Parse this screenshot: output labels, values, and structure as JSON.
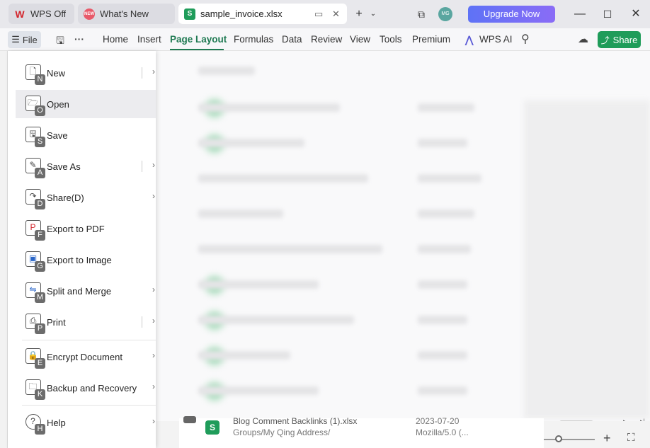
{
  "tabs": [
    {
      "label": "WPS Off",
      "icon": "wps-logo-icon"
    },
    {
      "label": "What's New",
      "icon": "new-badge-icon"
    },
    {
      "label": "sample_invoice.xlsx",
      "icon": "spreadsheet-icon"
    }
  ],
  "titlebar": {
    "avatar_text": "MG",
    "upgrade_label": "Upgrade Now"
  },
  "menubar": {
    "file_label": "File",
    "items": [
      "Home",
      "Insert",
      "Page Layout",
      "Formulas",
      "Data",
      "Review",
      "View",
      "Tools",
      "Premium"
    ],
    "active_item": "Page Layout",
    "wps_ai_label": "WPS AI",
    "share_label": "Share"
  },
  "file_menu": {
    "items": [
      {
        "label": "New",
        "key": "N",
        "submenu": true,
        "icon": "new-document-icon"
      },
      {
        "label": "Open",
        "key": "O",
        "submenu": false,
        "icon": "open-folder-icon"
      },
      {
        "label": "Save",
        "key": "S",
        "submenu": false,
        "icon": "save-icon"
      },
      {
        "label": "Save As",
        "key": "A",
        "submenu": true,
        "icon": "save-as-icon"
      },
      {
        "label": "Share(D)",
        "key": "D",
        "submenu": true,
        "icon": "share-icon"
      },
      {
        "label": "Export to PDF",
        "key": "F",
        "submenu": false,
        "icon": "pdf-icon"
      },
      {
        "label": "Export to Image",
        "key": "G",
        "submenu": false,
        "icon": "image-icon"
      },
      {
        "label": "Split and Merge",
        "key": "M",
        "submenu": true,
        "icon": "split-merge-icon"
      },
      {
        "label": "Print",
        "key": "P",
        "submenu": true,
        "icon": "print-icon"
      },
      {
        "label": "Encrypt Document",
        "key": "E",
        "submenu": true,
        "icon": "encrypt-icon"
      },
      {
        "label": "Backup and Recovery",
        "key": "K",
        "submenu": true,
        "icon": "backup-icon"
      },
      {
        "label": "Help",
        "key": "H",
        "submenu": true,
        "icon": "help-icon"
      }
    ],
    "hovered_item": "Open"
  },
  "recent_file": {
    "name": "Blog Comment Backlinks (1).xlsx",
    "path": "Groups/My Qing Address/",
    "date": "2023-07-20",
    "device": "Mozilla/5.0 (..."
  },
  "colors": {
    "accent": "#1f7a52",
    "share": "#1f9c5a",
    "upgrade_start": "#5e72f6",
    "upgrade_end": "#8a6cf6"
  }
}
